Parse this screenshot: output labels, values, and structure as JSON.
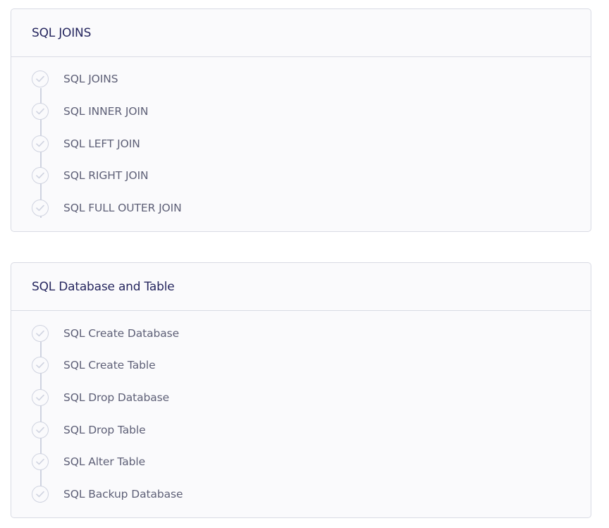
{
  "sections": [
    {
      "title": "SQL JOINS",
      "lessons": [
        {
          "label": "SQL JOINS"
        },
        {
          "label": "SQL INNER JOIN"
        },
        {
          "label": "SQL LEFT JOIN"
        },
        {
          "label": "SQL RIGHT JOIN"
        },
        {
          "label": "SQL FULL OUTER JOIN"
        }
      ]
    },
    {
      "title": "SQL Database and Table",
      "lessons": [
        {
          "label": "SQL Create Database"
        },
        {
          "label": "SQL Create Table"
        },
        {
          "label": "SQL Drop Database"
        },
        {
          "label": "SQL Drop Table"
        },
        {
          "label": "SQL Alter Table"
        },
        {
          "label": "SQL Backup Database"
        }
      ]
    }
  ],
  "icons": {
    "lesson_status": "check-circle-icon"
  },
  "colors": {
    "title": "#25265e",
    "lesson_text": "#5e6077",
    "check_outline": "#cfd3e0",
    "card_border": "#d9dbe4",
    "card_background": "#fafafc"
  }
}
